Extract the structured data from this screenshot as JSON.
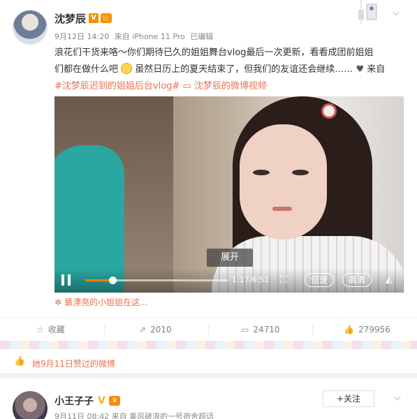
{
  "post": {
    "username": "沈梦辰",
    "badge_v": "V",
    "badge_crown": "👑",
    "date": "9月12日 14:20",
    "source": "来自 iPhone 11 Pro",
    "edited": "已编辑",
    "text_line1": "浪花们干货来咯～你们期待已久的姐姐舞台vlog最后一次更新，看看成团前姐姐",
    "text_line2a": "们都在做什么吧",
    "text_line2b": "虽然日历上的夏天结束了，但我们的友谊还会继续……",
    "text_line2c": "来自",
    "hashtag": "#沈梦辰迟到的姐姐后台vlog#",
    "video_link": "沈梦辰的微博视频",
    "video": {
      "expand_label": "展开",
      "time": "1:17/6:51",
      "progress": 0.19,
      "speed_label": "倍速",
      "quality_label": "高清"
    },
    "caption": "最漂亮的小姐姐在这...",
    "actions": {
      "favorite": "收藏",
      "repost": "2010",
      "comment": "24710",
      "like": "279956"
    }
  },
  "like_notice": "她9月11日赞过的微博",
  "post2": {
    "username": "小王子子",
    "badge_v": "V",
    "follow_label": "+关注",
    "meta": "9月11日 08:42 来自 乘风破浪的一号宿舍超话"
  },
  "icons": {
    "chevron": "chevron-down-icon",
    "star": "star-icon",
    "repost": "repost-icon",
    "comment": "comment-icon",
    "like": "thumb-up-icon"
  },
  "colors": {
    "accent": "#eb7350",
    "progress": "#ff8200",
    "badge": "#f29100"
  }
}
